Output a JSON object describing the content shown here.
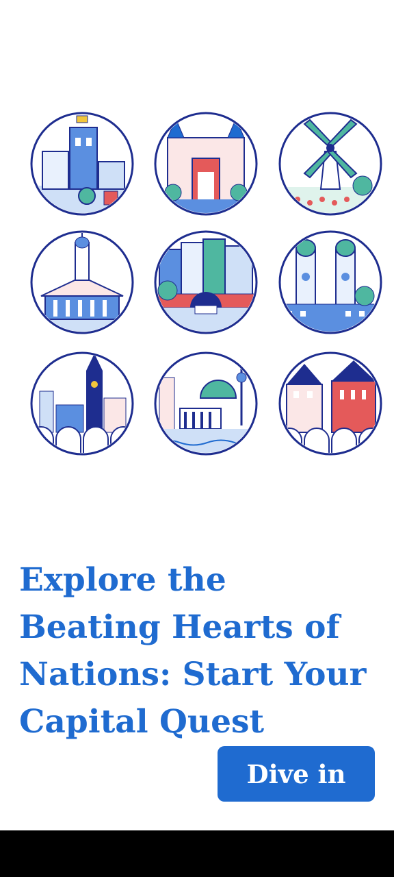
{
  "illustrations": [
    {
      "icon": "vilnius-castle-icon"
    },
    {
      "icon": "amsterdam-museum-icon"
    },
    {
      "icon": "windmill-icon"
    },
    {
      "icon": "cathedral-square-icon"
    },
    {
      "icon": "canal-houses-icon"
    },
    {
      "icon": "twin-towers-church-icon"
    },
    {
      "icon": "riga-skyline-icon"
    },
    {
      "icon": "berlin-landmarks-icon"
    },
    {
      "icon": "blackheads-house-icon"
    }
  ],
  "colors": {
    "primary": "#1f6bd0",
    "navy": "#1e2d8f",
    "green": "#4fb7a0",
    "red": "#e45a5a"
  },
  "content": {
    "headline": "Explore the Beating Hearts of Nations: Start Your Capital Quest",
    "cta_label": "Dive in"
  }
}
